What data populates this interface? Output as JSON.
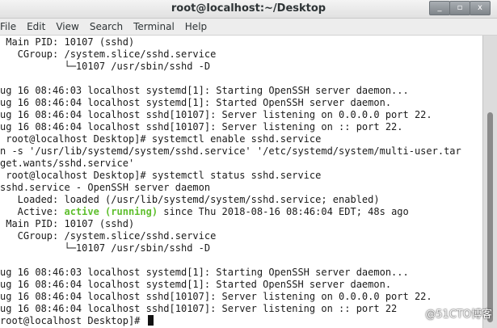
{
  "window": {
    "title": "root@localhost:~/Desktop",
    "buttons": [
      "_",
      "▫",
      "x"
    ]
  },
  "menubar": {
    "items": [
      "File",
      "Edit",
      "View",
      "Search",
      "Terminal",
      "Help"
    ]
  },
  "terminal": {
    "lines": [
      [
        {
          "t": " Main PID: 10107 (sshd)"
        }
      ],
      [
        {
          "t": "   CGroup: /system.slice/sshd.service"
        }
      ],
      [
        {
          "t": "           └─10107 /usr/sbin/sshd -D"
        }
      ],
      [
        {
          "t": ""
        }
      ],
      [
        {
          "t": "ug 16 08:46:03 localhost systemd[1]: Starting OpenSSH server daemon..."
        }
      ],
      [
        {
          "t": "ug 16 08:46:04 localhost systemd[1]: Started OpenSSH server daemon."
        }
      ],
      [
        {
          "t": "ug 16 08:46:04 localhost sshd[10107]: Server listening on 0.0.0.0 port 22."
        }
      ],
      [
        {
          "t": "ug 16 08:46:04 localhost sshd[10107]: Server listening on :: port 22."
        }
      ],
      [
        {
          "t": " root@localhost Desktop]# systemctl enable sshd.service"
        }
      ],
      [
        {
          "t": "n -s '/usr/lib/systemd/system/sshd.service' '/etc/systemd/system/multi-user.tar"
        }
      ],
      [
        {
          "t": "get.wants/sshd.service'"
        }
      ],
      [
        {
          "t": " root@localhost Desktop]# systemctl status sshd.service"
        }
      ],
      [
        {
          "t": "sshd.service - OpenSSH server daemon"
        }
      ],
      [
        {
          "t": "   Loaded: loaded (/usr/lib/systemd/system/sshd.service; enabled)"
        }
      ],
      [
        {
          "t": "   Active: "
        },
        {
          "t": "active (running)",
          "style": "active"
        },
        {
          "t": " since Thu 2018-08-16 08:46:04 EDT; 48s ago"
        }
      ],
      [
        {
          "t": " Main PID: 10107 (sshd)"
        }
      ],
      [
        {
          "t": "   CGroup: /system.slice/sshd.service"
        }
      ],
      [
        {
          "t": "           └─10107 /usr/sbin/sshd -D"
        }
      ],
      [
        {
          "t": ""
        }
      ],
      [
        {
          "t": "ug 16 08:46:03 localhost systemd[1]: Starting OpenSSH server daemon..."
        }
      ],
      [
        {
          "t": "ug 16 08:46:04 localhost systemd[1]: Started OpenSSH server daemon."
        }
      ],
      [
        {
          "t": "ug 16 08:46:04 localhost sshd[10107]: Server listening on 0.0.0.0 port 22."
        }
      ],
      [
        {
          "t": "ug 16 08:46:04 localhost sshd[10107]: Server listening on :: port 22"
        }
      ],
      [
        {
          "t": "root@localhost Desktop]# "
        }
      ]
    ],
    "colors": {
      "active": "#5fbf2e",
      "text": "#1a1a1a",
      "background": "#ffffff"
    }
  },
  "watermark": {
    "text": "@51CTO博客"
  }
}
